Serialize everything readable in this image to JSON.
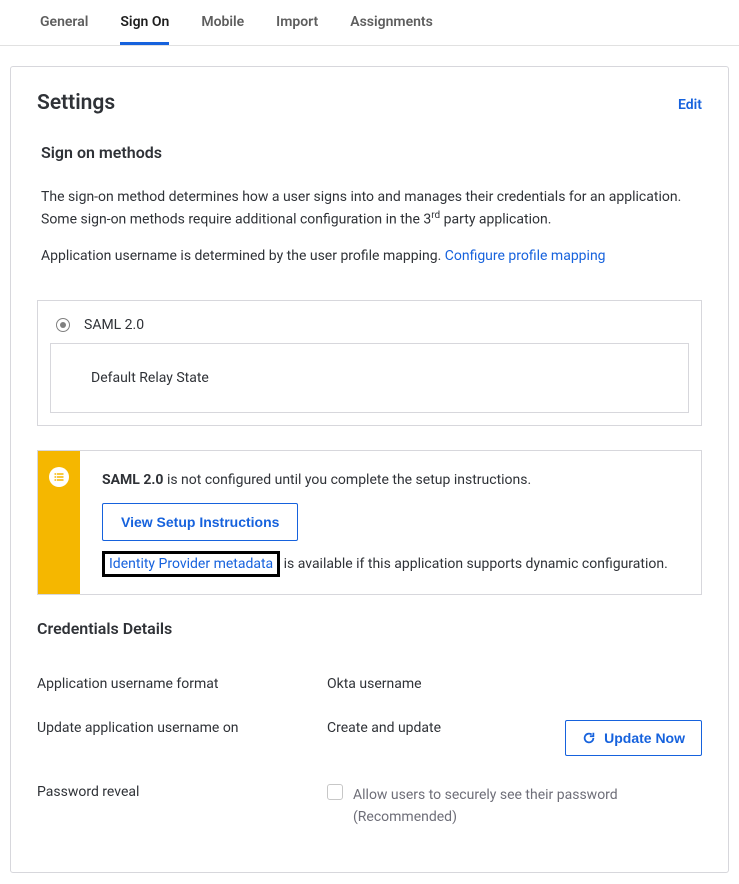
{
  "tabs": [
    {
      "label": "General"
    },
    {
      "label": "Sign On"
    },
    {
      "label": "Mobile"
    },
    {
      "label": "Import"
    },
    {
      "label": "Assignments"
    }
  ],
  "header": {
    "title": "Settings",
    "edit": "Edit"
  },
  "methods": {
    "title": "Sign on methods",
    "desc1a": "The sign-on method determines how a user signs into and manages their credentials for an application. Some sign-on methods require additional configuration in the 3",
    "desc1b": " party application.",
    "sup": "rd",
    "desc2": "Application username is determined by the user profile mapping. ",
    "configureLink": "Configure profile mapping",
    "radioLabel": "SAML 2.0",
    "relay": "Default Relay State"
  },
  "alert": {
    "bold": "SAML 2.0",
    "text1": " is not configured until you complete the setup instructions.",
    "button": "View Setup Instructions",
    "idpLink": "Identity Provider metadata",
    "text2": " is available if this application supports dynamic configuration."
  },
  "creds": {
    "title": "Credentials Details",
    "rows": {
      "usernameFormat": {
        "label": "Application username format",
        "value": "Okta username"
      },
      "updateOn": {
        "label": "Update application username on",
        "value": "Create and update",
        "button": "Update Now"
      },
      "passwordReveal": {
        "label": "Password reveal",
        "checkbox": "Allow users to securely see their password (Recommended)"
      }
    }
  }
}
